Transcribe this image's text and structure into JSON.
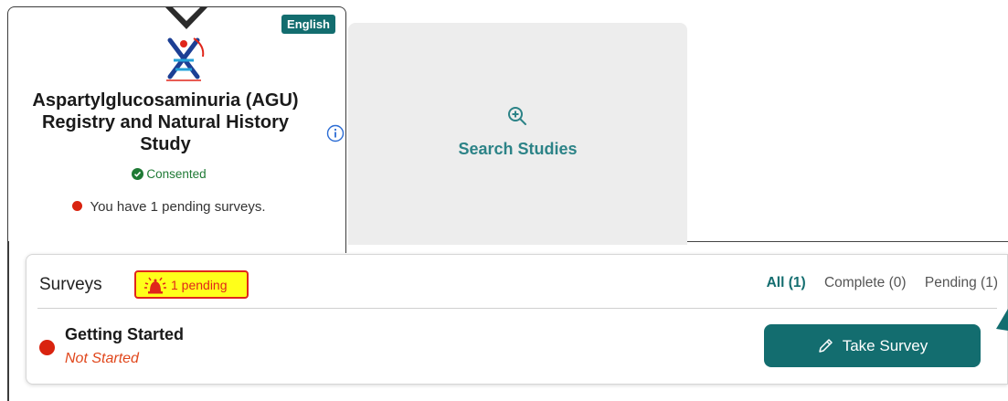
{
  "study": {
    "language_badge": "English",
    "title": "Aspartylglucosaminuria (AGU) Registry and Natural History Study",
    "status": "Consented",
    "pending_text": "You have 1 pending surveys.",
    "logo_icon": "agu-registry-logo"
  },
  "search_tile": {
    "label": "Search Studies",
    "icon": "zoom-in-icon"
  },
  "surveys": {
    "title": "Surveys",
    "badge": "1 pending",
    "filters": {
      "all": "All (1)",
      "complete": "Complete (0)",
      "pending": "Pending (1)"
    },
    "items": [
      {
        "name": "Getting Started",
        "status": "Not Started",
        "action": "Take Survey"
      }
    ]
  },
  "colors": {
    "brand": "#136d6f",
    "alert": "#d9230f",
    "badge_bg": "#ffff1a",
    "consented": "#1f7a35"
  }
}
